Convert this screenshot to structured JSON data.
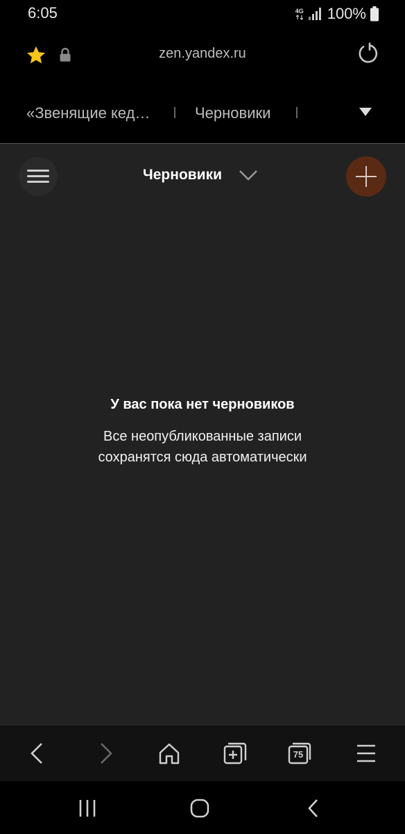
{
  "status_bar": {
    "time": "6:05",
    "network": "4G",
    "battery": "100%"
  },
  "address_bar": {
    "url": "zen.yandex.ru"
  },
  "tabs": [
    {
      "label": "«Звенящие кед…"
    },
    {
      "label": "Черновики"
    }
  ],
  "page": {
    "title": "Черновики",
    "empty_title": "У вас пока нет черновиков",
    "empty_description": "Все неопубликованные записи сохранятся сюда автоматически"
  },
  "toolbar": {
    "tabs_count": "75"
  },
  "colors": {
    "star": "#f5c518",
    "add_button": "#5a2a14",
    "page_background": "#222222"
  }
}
